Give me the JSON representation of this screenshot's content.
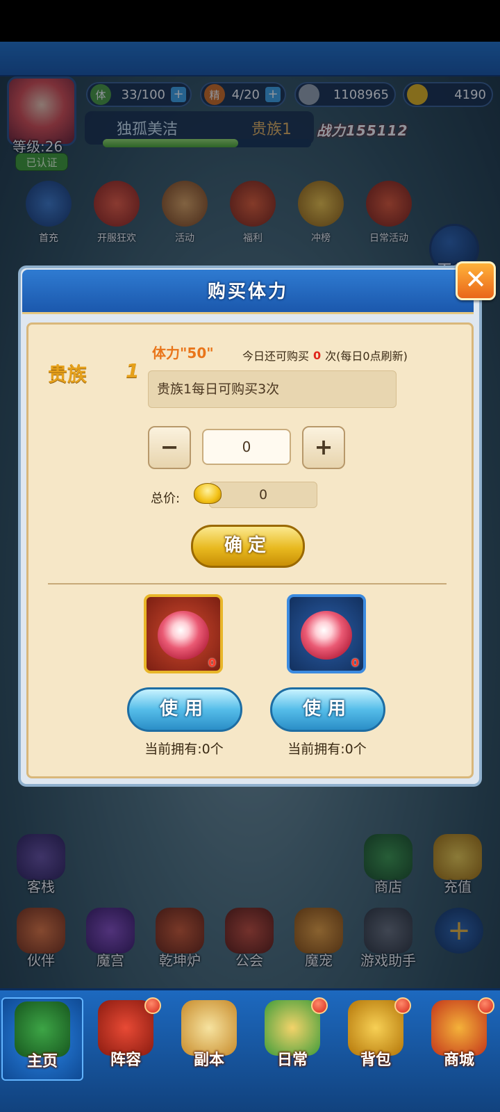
{
  "hud": {
    "stamina_icon": "体",
    "stamina": "33/100",
    "energy_icon": "精",
    "energy": "4/20",
    "coins": "1108965",
    "gold": "4190",
    "level": "等级:26",
    "verified": "已认证",
    "player_name": "独孤美洁",
    "vip": "贵族1",
    "power": "战力155112",
    "exp_fraction": 0.65
  },
  "features": [
    {
      "label": "首充"
    },
    {
      "label": "开服狂欢"
    },
    {
      "label": "活动"
    },
    {
      "label": "福利"
    },
    {
      "label": "冲榜"
    },
    {
      "label": "日常活动"
    }
  ],
  "more_label": "更多",
  "hall_row1": [
    {
      "label": "客栈"
    },
    {
      "label": "商店"
    },
    {
      "label": "充值"
    }
  ],
  "hall_row2": [
    {
      "label": "伙伴"
    },
    {
      "label": "魔宫"
    },
    {
      "label": "乾坤炉"
    },
    {
      "label": "公会"
    },
    {
      "label": "魔宠"
    },
    {
      "label": "游戏助手"
    }
  ],
  "bottom_nav": [
    {
      "label": "主页"
    },
    {
      "label": "阵容"
    },
    {
      "label": "副本"
    },
    {
      "label": "日常"
    },
    {
      "label": "背包"
    },
    {
      "label": "商城"
    }
  ],
  "modal": {
    "title": "购买体力",
    "close": "✕",
    "noble": "贵族",
    "noble_level": "1",
    "stamina_amount": "体力\"50\"",
    "remain_prefix": "今日还可购买",
    "remain_count": "0",
    "remain_suffix": "次(每日0点刷新)",
    "description": "贵族1每日可购买3次",
    "minus": "−",
    "plus": "+",
    "quantity": "0",
    "total_label": "总价:",
    "total_value": "0",
    "confirm": "确定",
    "items": [
      {
        "count": "0",
        "use": "使用",
        "owned": "当前拥有:0个"
      },
      {
        "count": "0",
        "use": "使用",
        "owned": "当前拥有:0个"
      }
    ]
  },
  "colors": {
    "header_blue": "#1f6fc6",
    "panel_bg": "#f6e7c7",
    "confirm_gold": "#e8b91f",
    "use_blue": "#55bde9",
    "close_orange": "#e9661a"
  }
}
